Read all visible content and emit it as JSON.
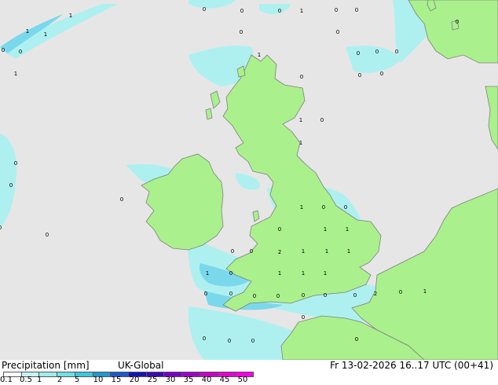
{
  "legend": {
    "title": "Precipitation [mm]",
    "model": "UK-Global",
    "valid_time": "Fr 13-02-2026 16..17 UTC (00+41)",
    "ticks": [
      "0.1",
      "0.5",
      "1",
      "2",
      "5",
      "10",
      "15",
      "20",
      "25",
      "30",
      "35",
      "40",
      "45",
      "50"
    ],
    "colors": [
      "#ffffff",
      "#c6f5f5",
      "#9eecec",
      "#6ee0e6",
      "#3cc6e0",
      "#2196d2",
      "#1e5ac8",
      "#1414b4",
      "#3c0ab4",
      "#7800c8",
      "#a000c8",
      "#c800c8",
      "#e600d2",
      "#ff00e6"
    ]
  },
  "colors": {
    "sea": "#e6e6e6",
    "land": "#aaf08c",
    "coast": "#808080",
    "light_precip": "#aef0f0",
    "med_precip": "#7ad8ec"
  },
  "map_values": [
    "1",
    "1",
    "1",
    "0",
    "1",
    "0",
    "0",
    "0",
    "0",
    "1",
    "0",
    "0",
    "1",
    "0",
    "0",
    "0",
    "0",
    "0",
    "0",
    "0",
    "0",
    "0",
    "1",
    "1",
    "0",
    "0",
    "0",
    "0",
    "0",
    "0",
    "0",
    "0",
    "2",
    "1",
    "1",
    "1",
    "1",
    "0",
    "0",
    "0",
    "1",
    "1",
    "1",
    "1",
    "1",
    "1",
    "0",
    "0",
    "0",
    "0",
    "0",
    "0",
    "0",
    "2",
    "0",
    "1",
    "0",
    "0",
    "0",
    "0",
    "0",
    "0"
  ]
}
